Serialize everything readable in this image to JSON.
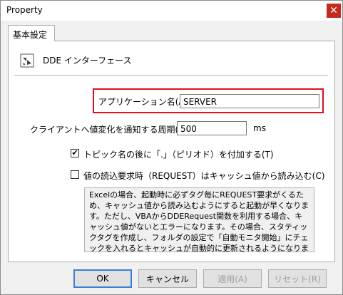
{
  "window": {
    "title": "Property",
    "close_icon": "close-icon"
  },
  "tabs": [
    {
      "label": "基本設定"
    }
  ],
  "header": {
    "icon": "dde-interface-icon",
    "text": "DDE インターフェース"
  },
  "application_name": {
    "label": "アプリケーション名(A) :",
    "value": "SERVER"
  },
  "notify_period": {
    "label": "クライアントへ値変化を通知する周期(U) :",
    "value": "500",
    "unit": "ms"
  },
  "options": {
    "topic_period": {
      "label": "トピック名の後に「.」（ピリオド）を付加する(T)",
      "checked": true
    },
    "request_cache": {
      "label": "値の読込要求時（REQUEST）はキャッシュ値から読み込む(C)",
      "checked": false
    }
  },
  "description": "Excelの場合、起動時に必ずタグ毎にREQUEST要求がくるため、キャッシュ値から読み込むようにすると起動が早くなります。ただし、VBAからDDERequest関数を利用する場合、キャッシュ値がないとエラーになります。その場合、スタティックタグを作成し、フォルダの設定で「自動モニタ開始」にチェックを入れるとキャッシュが自動的に更新されるようになります。",
  "buttons": {
    "ok": "OK",
    "cancel": "キャンセル",
    "apply": "適用(A)",
    "reset": "リセット(R)"
  }
}
